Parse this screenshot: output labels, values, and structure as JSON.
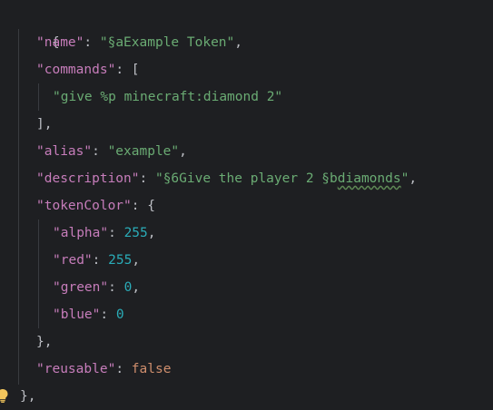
{
  "colors": {
    "background": "#1e1f22",
    "key": "#c77dbb",
    "string": "#6aab73",
    "number": "#2aacb8",
    "keyword": "#cf8e6d",
    "punctuation": "#bcbec4",
    "indent_guide": "#393b40",
    "bulb": "#f2c55c"
  },
  "gutter_icon": "lightbulb-icon",
  "code": {
    "open_brace": "{",
    "name_key": "\"name\"",
    "name_value": "\"§aExample Token\"",
    "commands_key": "\"commands\"",
    "commands_open": "[",
    "command_0": "\"give %p minecraft:diamond 2\"",
    "commands_close": "],",
    "alias_key": "\"alias\"",
    "alias_value": "\"example\"",
    "description_key": "\"description\"",
    "description_value_prefix": "\"§6Give the player 2 §b",
    "description_value_typo": "diamonds",
    "description_value_suffix": "\"",
    "tokenColor_key": "\"tokenColor\"",
    "tokenColor_open": "{",
    "alpha_key": "\"alpha\"",
    "alpha_value": "255",
    "red_key": "\"red\"",
    "red_value": "255",
    "green_key": "\"green\"",
    "green_value": "0",
    "blue_key": "\"blue\"",
    "blue_value": "0",
    "tokenColor_close": "},",
    "reusable_key": "\"reusable\"",
    "reusable_value": "false",
    "close_brace": "},"
  }
}
